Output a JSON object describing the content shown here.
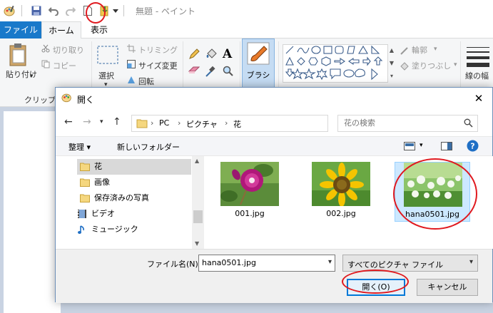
{
  "window": {
    "title": "無題 - ペイント"
  },
  "ribbon": {
    "tabs": [
      {
        "label": "ファイル"
      },
      {
        "label": "ホーム"
      },
      {
        "label": "表示"
      }
    ],
    "paste_label": "貼り付け",
    "cut_label": "切り取り",
    "copy_label": "コピー",
    "clipboard_group": "クリップボ",
    "select_label": "選択",
    "crop_label": "トリミング",
    "resize_label": "サイズ変更",
    "rotate_label": "回転",
    "brush_label": "ブラシ",
    "outline_label": "輪郭",
    "fill_label": "塗りつぶし",
    "line_width_label": "線の幅"
  },
  "dialog": {
    "title": "開く",
    "breadcrumb": [
      "PC",
      "ピクチャ",
      "花"
    ],
    "search_placeholder": "花の検索",
    "organize_label": "整理 ▾",
    "new_folder_label": "新しいフォルダー",
    "nav_items": [
      {
        "label": "花",
        "icon": "folder-icon",
        "selected": true
      },
      {
        "label": "画像",
        "icon": "folder-icon",
        "selected": false
      },
      {
        "label": "保存済みの写真",
        "icon": "folder-icon",
        "selected": false
      },
      {
        "label": "ビデオ",
        "icon": "video-icon",
        "selected": false
      },
      {
        "label": "ミュージック",
        "icon": "music-icon",
        "selected": false
      }
    ],
    "files": [
      {
        "name": "001.jpg",
        "selected": false
      },
      {
        "name": "002.jpg",
        "selected": false
      },
      {
        "name": "hana0501.jpg",
        "selected": true
      }
    ],
    "filename_label": "ファイル名(N):",
    "filename_value": "hana0501.jpg",
    "filetype_value": "すべてのピクチャ ファイル",
    "open_label": "開く(O)",
    "cancel_label": "キャンセル"
  },
  "colors": {
    "accent": "#1979ca",
    "annotation_red": "#e0191f",
    "selection": "#cce8ff"
  }
}
